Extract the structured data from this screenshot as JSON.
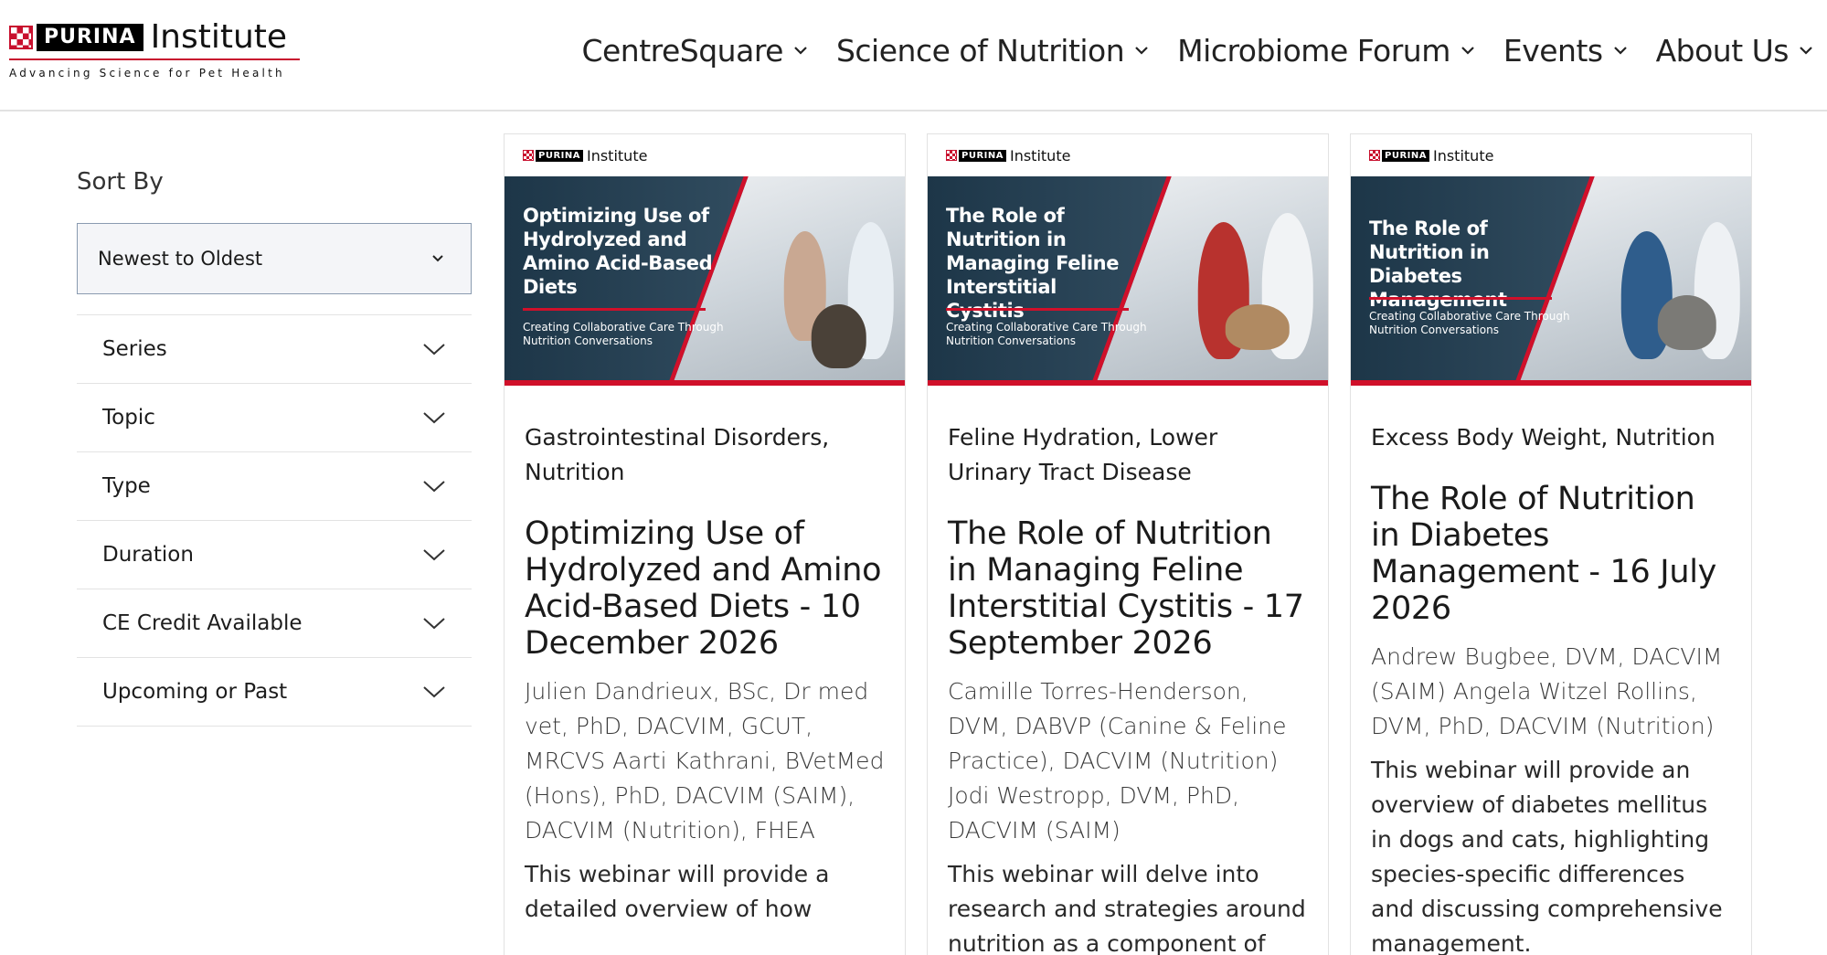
{
  "logo": {
    "brand": "PURINA",
    "name": "Institute",
    "tagline": "Advancing Science for Pet Health"
  },
  "nav": {
    "items": [
      {
        "label": "CentreSquare"
      },
      {
        "label": "Science of Nutrition"
      },
      {
        "label": "Microbiome Forum"
      },
      {
        "label": "Events"
      },
      {
        "label": "About Us"
      }
    ]
  },
  "sidebar": {
    "sort_title": "Sort By",
    "sort_value": "Newest to Oldest",
    "filters": [
      {
        "label": "Series"
      },
      {
        "label": "Topic"
      },
      {
        "label": "Type"
      },
      {
        "label": "Duration"
      },
      {
        "label": "CE Credit Available"
      },
      {
        "label": "Upcoming or Past"
      }
    ]
  },
  "cards": [
    {
      "thumb_brand": "PURINA",
      "thumb_name": "Institute",
      "banner_title": "Optimizing Use of Hydrolyzed and Amino Acid-Based Diets",
      "banner_sub": "Creating Collaborative Care Through Nutrition Conversations",
      "topics": "Gastrointestinal Disorders, Nutrition",
      "title": "Optimizing Use of Hydrolyzed and Amino Acid-Based Diets - 10 December 2026",
      "authors": "Julien Dandrieux, BSc, Dr med vet, PhD, DACVIM, GCUT, MRCVS Aarti Kathrani, BVetMed (Hons), PhD, DACVIM (SAIM), DACVIM (Nutrition), FHEA",
      "desc": "This webinar will provide a detailed overview of how"
    },
    {
      "thumb_brand": "PURINA",
      "thumb_name": "Institute",
      "banner_title": "The Role of Nutrition in Managing Feline Interstitial Cystitis",
      "banner_sub": "Creating Collaborative Care Through Nutrition Conversations",
      "topics": "Feline Hydration, Lower Urinary Tract Disease",
      "title": "The Role of Nutrition in Managing Feline Interstitial Cystitis - 17 September 2026",
      "authors": "Camille Torres-Henderson, DVM, DABVP (Canine & Feline Practice), DACVIM (Nutrition) Jodi Westropp, DVM, PhD, DACVIM (SAIM)",
      "desc": "This webinar will delve into research and strategies around nutrition as a component of"
    },
    {
      "thumb_brand": "PURINA",
      "thumb_name": "Institute",
      "banner_title": "The Role of Nutrition in Diabetes Management",
      "banner_sub": "Creating Collaborative Care Through Nutrition Conversations",
      "topics": "Excess Body Weight, Nutrition",
      "title": "The Role of Nutrition in Diabetes Management - 16 July 2026",
      "authors": "Andrew Bugbee, DVM, DACVIM (SAIM) Angela Witzel Rollins, DVM, PhD, DACVIM (Nutrition)",
      "desc": "This webinar will provide an overview of diabetes mellitus in dogs and cats, highlighting species-specific differences and discussing comprehensive management."
    }
  ],
  "colors": {
    "brand_red": "#c8102e",
    "banner_dark": "#1d3648"
  }
}
